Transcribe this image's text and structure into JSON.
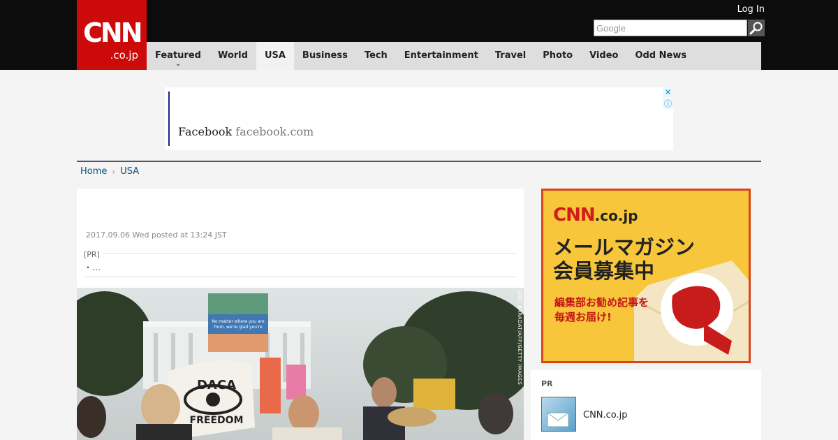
{
  "header": {
    "logo_main": "CNN",
    "logo_sub": ".co.jp",
    "login_label": "Log In",
    "search_placeholder": "Google"
  },
  "nav": {
    "items": [
      {
        "label": "Featured"
      },
      {
        "label": "World"
      },
      {
        "label": "USA"
      },
      {
        "label": "Business"
      },
      {
        "label": "Tech"
      },
      {
        "label": "Entertainment"
      },
      {
        "label": "Travel"
      },
      {
        "label": "Photo"
      },
      {
        "label": "Video"
      },
      {
        "label": "Odd News"
      }
    ],
    "active": "USA"
  },
  "ad": {
    "brand": "Facebook",
    "domain": "facebook.com"
  },
  "breadcrumb": {
    "home": "Home",
    "current": "USA"
  },
  "article": {
    "date": "2017.09.06 Wed posted at 13:24 JST",
    "pr_label": "[PR]",
    "pr_link": "・…",
    "photo_credit": "ERIC BARADAT/AFP/GETTY IMAGES",
    "sign_text": "No importa de donde eras, estamos contentos que seas nuestro vecino. No matter where you are from, we're glad you're our neighbor.",
    "banner_text": "DACA FREEDOM"
  },
  "sidebar": {
    "promo_logo": "CNN",
    "promo_logo_sub": ".co.jp",
    "promo_title_1": "メールマガジン",
    "promo_title_2": "会員募集中",
    "promo_sub_1": "編集部お勧め記事を",
    "promo_sub_2": "毎週お届け!",
    "pr_label": "PR",
    "pr_name": "CNN.co.jp"
  },
  "colors": {
    "brand_red": "#cc0a0a",
    "link_blue": "#0b4f7a",
    "promo_yellow": "#f7c63a"
  }
}
